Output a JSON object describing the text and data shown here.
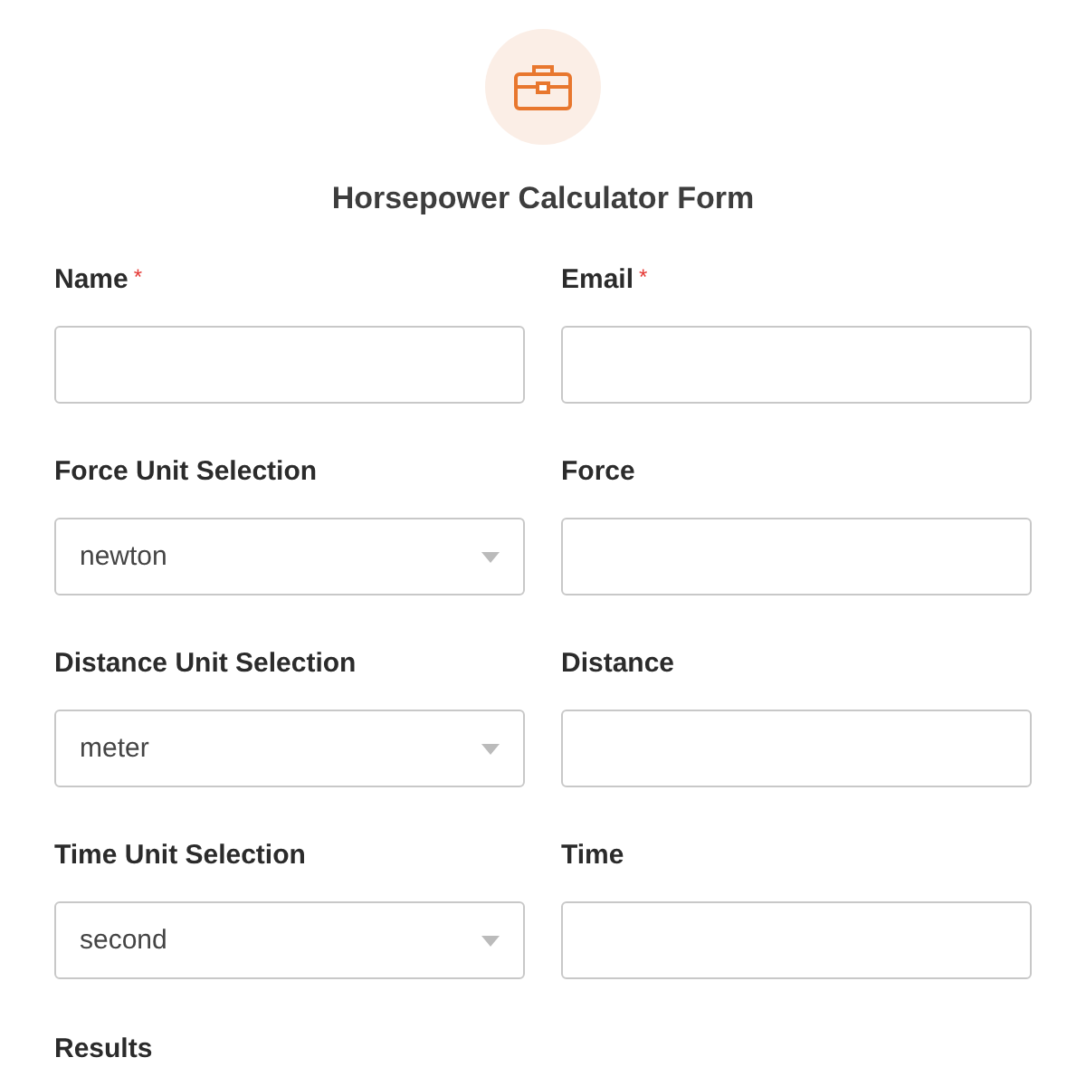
{
  "form": {
    "title": "Horsepower Calculator Form",
    "fields": [
      {
        "kind": "text",
        "label": "Name",
        "required_mark": "*"
      },
      {
        "kind": "text",
        "label": "Email",
        "required_mark": "*"
      },
      {
        "kind": "select",
        "label": "Force Unit Selection",
        "value": "newton"
      },
      {
        "kind": "text",
        "label": "Force"
      },
      {
        "kind": "select",
        "label": "Distance Unit Selection",
        "value": "meter"
      },
      {
        "kind": "text",
        "label": "Distance"
      },
      {
        "kind": "select",
        "label": "Time Unit Selection",
        "value": "second"
      },
      {
        "kind": "text",
        "label": "Time"
      }
    ],
    "results_label": "Results"
  }
}
